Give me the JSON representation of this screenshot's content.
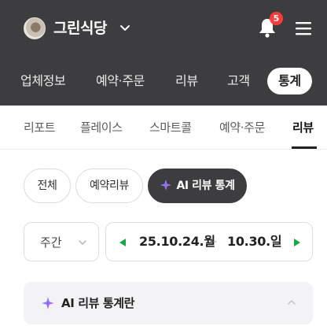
{
  "header": {
    "store_name": "그린식당",
    "notification_count": "5",
    "icons": {
      "avatar": "store-avatar",
      "bell": "bell-icon",
      "menu": "menu-icon",
      "chevron": "chevron-down-icon"
    }
  },
  "main_tabs": [
    {
      "label": "업체정보"
    },
    {
      "label": "예약·주문"
    },
    {
      "label": "리뷰"
    },
    {
      "label": "고객"
    },
    {
      "label": "통계",
      "active": true
    }
  ],
  "sub_tabs": [
    {
      "label": "리포트"
    },
    {
      "label": "플레이스"
    },
    {
      "label": "스마트콜"
    },
    {
      "label": "예약·주문"
    },
    {
      "label": "리뷰",
      "active": true
    }
  ],
  "filters": [
    {
      "label": "전체"
    },
    {
      "label": "예약리뷰"
    },
    {
      "label": "AI 리뷰 통계",
      "active": true
    }
  ],
  "period": {
    "selected": "주간"
  },
  "date_range": {
    "start": "25.10.24.월",
    "separator": "-",
    "end": "10.30.일"
  },
  "ai_panel": {
    "title": "AI 리뷰 통계란"
  },
  "colors": {
    "header_bg": "#3d3d3f",
    "accent_green": "#1aa84a",
    "badge_red": "#ff3b3b",
    "panel_bg": "#f3f3f6"
  }
}
